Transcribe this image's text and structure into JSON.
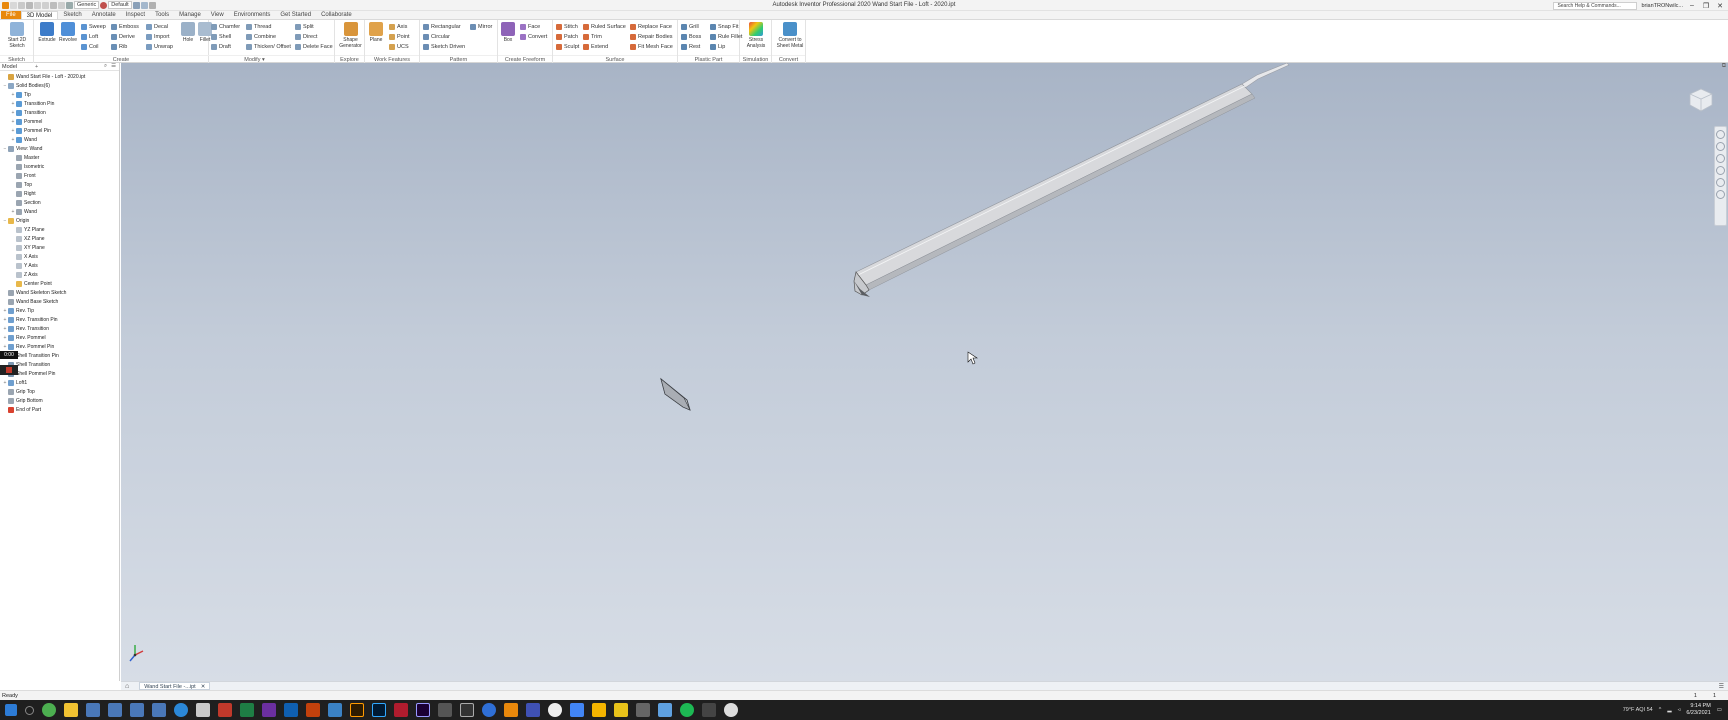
{
  "titlebar": {
    "style_dropdown": "Generic",
    "display_dropdown": "Default",
    "window_title": "Autodesk Inventor Professional 2020   Wand Start File - Loft - 2020.ipt",
    "search_placeholder": "Search Help & Commands...",
    "user": "brianTRONwilc...",
    "minimize": "–",
    "restore": "❐",
    "close": "✕"
  },
  "tabs": [
    "File",
    "3D Model",
    "Sketch",
    "Annotate",
    "Inspect",
    "Tools",
    "Manage",
    "View",
    "Environments",
    "Get Started",
    "Collaborate"
  ],
  "ribbon": {
    "sketch": {
      "title": "Sketch",
      "start": "Start 2D Sketch"
    },
    "create": {
      "title": "Create",
      "extrude": "Extrude",
      "revolve": "Revolve",
      "sweep": "Sweep",
      "loft": "Loft",
      "coil": "Coil",
      "emboss": "Emboss",
      "derive": "Derive",
      "rib": "Rib",
      "decal": "Decal",
      "import": "Import",
      "unwrap": "Unwrap"
    },
    "modify": {
      "title": "Modify ▾",
      "hole": "Hole",
      "fillet": "Fillet",
      "chamfer": "Chamfer",
      "shell": "Shell",
      "draft": "Draft",
      "thread": "Thread",
      "combine": "Combine",
      "thicken": "Thicken/ Offset",
      "split": "Split",
      "direct": "Direct",
      "delete_face": "Delete Face"
    },
    "explore": {
      "title": "Explore",
      "shape_gen": "Shape Generator"
    },
    "work_features": {
      "title": "Work Features",
      "plane": "Plane",
      "axis": "Axis",
      "point": "Point",
      "ucs": "UCS"
    },
    "pattern": {
      "title": "Pattern",
      "rectangular": "Rectangular",
      "circular": "Circular",
      "sketch_driven": "Sketch Driven",
      "mirror": "Mirror"
    },
    "freeform": {
      "title": "Create Freeform",
      "box": "Box",
      "face": "Face",
      "convert": "Convert"
    },
    "surface": {
      "title": "Surface",
      "stitch": "Stitch",
      "patch": "Patch",
      "sculpt": "Sculpt",
      "ruled": "Ruled Surface",
      "trim": "Trim",
      "extend": "Extend",
      "replace": "Replace Face",
      "repair": "Repair Bodies",
      "fit_mesh": "Fit Mesh Face"
    },
    "plastic": {
      "title": "Plastic Part",
      "grill": "Grill",
      "boss": "Boss",
      "rest": "Rest",
      "snap_fit": "Snap Fit",
      "rule_fillet": "Rule Fillet",
      "lip": "Lip"
    },
    "simulation": {
      "title": "Simulation",
      "stress": "Stress Analysis"
    },
    "convert": {
      "title": "Convert",
      "sheet_metal": "Convert to Sheet Metal"
    }
  },
  "browser": {
    "header": "Model",
    "plus": "+",
    "tree": [
      {
        "label": "Wand Start File - Loft - 2020.ipt",
        "level": 0,
        "exp": "",
        "color": "#d9a441"
      },
      {
        "label": "Solid Bodies(6)",
        "level": 0,
        "exp": "−",
        "color": "#8ba7c4"
      },
      {
        "label": "Tip",
        "level": 1,
        "exp": "+",
        "color": "#5b9bd5"
      },
      {
        "label": "Transition Pin",
        "level": 1,
        "exp": "+",
        "color": "#5b9bd5"
      },
      {
        "label": "Transition",
        "level": 1,
        "exp": "+",
        "color": "#5b9bd5"
      },
      {
        "label": "Pommel",
        "level": 1,
        "exp": "+",
        "color": "#5b9bd5"
      },
      {
        "label": "Pommel Pin",
        "level": 1,
        "exp": "+",
        "color": "#5b9bd5"
      },
      {
        "label": "Wand",
        "level": 1,
        "exp": "+",
        "color": "#5b9bd5"
      },
      {
        "label": "View: Wand",
        "level": 0,
        "exp": "−",
        "color": "#8fa3b8"
      },
      {
        "label": "Master",
        "level": 1,
        "exp": "",
        "color": "#9aa5b1"
      },
      {
        "label": "Isometric",
        "level": 1,
        "exp": "",
        "color": "#9aa5b1"
      },
      {
        "label": "Front",
        "level": 1,
        "exp": "",
        "color": "#9aa5b1"
      },
      {
        "label": "Top",
        "level": 1,
        "exp": "",
        "color": "#9aa5b1"
      },
      {
        "label": "Right",
        "level": 1,
        "exp": "",
        "color": "#9aa5b1"
      },
      {
        "label": "Section",
        "level": 1,
        "exp": "",
        "color": "#9aa5b1"
      },
      {
        "label": "Wand",
        "level": 1,
        "exp": "+",
        "color": "#9aa5b1"
      },
      {
        "label": "Origin",
        "level": 0,
        "exp": "−",
        "color": "#e8b84a"
      },
      {
        "label": "YZ Plane",
        "level": 1,
        "exp": "",
        "color": "#b9c2cc"
      },
      {
        "label": "XZ Plane",
        "level": 1,
        "exp": "",
        "color": "#b9c2cc"
      },
      {
        "label": "XY Plane",
        "level": 1,
        "exp": "",
        "color": "#b9c2cc"
      },
      {
        "label": "X Axis",
        "level": 1,
        "exp": "",
        "color": "#b9c2cc"
      },
      {
        "label": "Y Axis",
        "level": 1,
        "exp": "",
        "color": "#b9c2cc"
      },
      {
        "label": "Z Axis",
        "level": 1,
        "exp": "",
        "color": "#b9c2cc"
      },
      {
        "label": "Center Point",
        "level": 1,
        "exp": "",
        "color": "#e8b84a"
      },
      {
        "label": "Wand Skeleton Sketch",
        "level": 0,
        "exp": "",
        "color": "#9aa5b1"
      },
      {
        "label": "Wand Base Sketch",
        "level": 0,
        "exp": "",
        "color": "#9aa5b1"
      },
      {
        "label": "Rev. Tip",
        "level": 0,
        "exp": "+",
        "color": "#6f9fcf"
      },
      {
        "label": "Rev. Transition Pin",
        "level": 0,
        "exp": "+",
        "color": "#6f9fcf"
      },
      {
        "label": "Rev. Transition",
        "level": 0,
        "exp": "+",
        "color": "#6f9fcf"
      },
      {
        "label": "Rev. Pommel",
        "level": 0,
        "exp": "+",
        "color": "#6f9fcf"
      },
      {
        "label": "Rev. Pommel Pin",
        "level": 0,
        "exp": "+",
        "color": "#6f9fcf"
      },
      {
        "label": "Shell Transition Pin",
        "level": 0,
        "exp": "",
        "color": "#7c98b3"
      },
      {
        "label": "Shell Transition",
        "level": 0,
        "exp": "",
        "color": "#7c98b3"
      },
      {
        "label": "Shell Pommel Pin",
        "level": 0,
        "exp": "",
        "color": "#7c98b3"
      },
      {
        "label": "Loft1",
        "level": 0,
        "exp": "+",
        "color": "#6f9fcf"
      },
      {
        "label": "Grip Top",
        "level": 0,
        "exp": "",
        "color": "#9aa5b1"
      },
      {
        "label": "Grip Bottom",
        "level": 0,
        "exp": "",
        "color": "#9aa5b1"
      },
      {
        "label": "End of Part",
        "level": 0,
        "exp": "",
        "color": "#d9412f"
      }
    ],
    "timer": "0:00"
  },
  "doctab": {
    "label": "Wand Start File -...ipt",
    "close": "✕"
  },
  "status": {
    "text": "Ready",
    "num1": "1",
    "num2": "1"
  },
  "tray": {
    "weather": "79°F  AQI 54",
    "time": "9:14 PM",
    "date": "6/23/2021"
  },
  "colors": {
    "accent": "#e8880c",
    "taskbar": "#1f1f1f"
  }
}
